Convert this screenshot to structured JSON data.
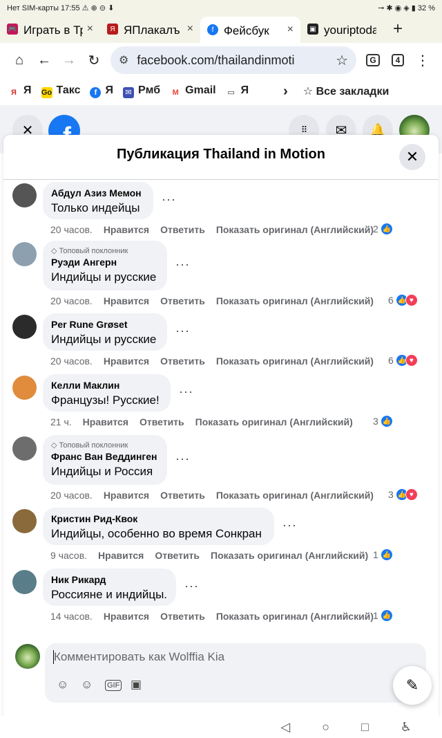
{
  "status": {
    "left": "Нет SIM-карты 17:55 ⚠ ⊕ ⊝ ⬇",
    "right": "⊸ ✱ ◉ ◈ ▮ 32 %"
  },
  "tabs": [
    {
      "label": "Играть в Тр",
      "fav_color": "#c2185b",
      "fav": "🎮"
    },
    {
      "label": "ЯПлакалъ -",
      "fav_color": "#b71c1c",
      "fav": "Я"
    },
    {
      "label": "Фейсбук",
      "fav_color": "#1877f2",
      "fav": "f"
    },
    {
      "label": "youriptoday",
      "fav_color": "#222222",
      "fav": "▣"
    }
  ],
  "tab_close": "×",
  "tab_plus": "+",
  "url": {
    "text": "facebook.com/thailandinmoti",
    "home": "⌂",
    "back": "←",
    "forward": "→",
    "reload": "↻",
    "star": "☆",
    "translate": "G",
    "tabs_count": "4",
    "menu": "⋮",
    "tune": "⚙"
  },
  "bookmarks": [
    {
      "label": "Я",
      "color": "#d32f2f",
      "ic": "Я"
    },
    {
      "label": "Такс",
      "color": "#222",
      "ic": "Go"
    },
    {
      "label": "Я",
      "color": "#1877f2",
      "ic": "f"
    },
    {
      "label": "Рмб",
      "color": "#3f51b5",
      "ic": "✉"
    },
    {
      "label": "Gmail",
      "color": "#ea4335",
      "ic": "M"
    },
    {
      "label": "Я",
      "color": "#fff",
      "ic": "▭"
    }
  ],
  "bookmarks_more": "›",
  "bookmarks_all": "☆ Все закладки",
  "fb": {
    "logo": "f",
    "close": "✕",
    "menu": "⋮⋮⋮",
    "messenger": "✉",
    "bell": "🔔"
  },
  "modal": {
    "title": "Публикация Thailand in Motion",
    "close": "✕"
  },
  "comments": [
    {
      "name": "Абдул Азиз Мемон",
      "badge": "",
      "text": "Только индейцы",
      "time": "20 часов.",
      "like": "Нравится",
      "reply": "Ответить",
      "translate": "Показать оригинал (Английский)",
      "count": "2",
      "reactions": [
        "like"
      ],
      "avatar": "#555"
    },
    {
      "name": "Руэди Ангерн",
      "badge": "Топовый поклонник",
      "text": "Индийцы и русские",
      "time": "20 часов.",
      "like": "Нравится",
      "reply": "Ответить",
      "translate": "Показать оригинал (Английский)",
      "count": "6",
      "reactions": [
        "like",
        "love"
      ],
      "avatar": "#8da0b0"
    },
    {
      "name": "Per Rune Grøset",
      "badge": "",
      "text": "Индийцы и русские",
      "time": "20 часов.",
      "like": "Нравится",
      "reply": "Ответить",
      "translate": "Показать оригинал (Английский)",
      "count": "6",
      "reactions": [
        "like",
        "love"
      ],
      "avatar": "#2b2b2b"
    },
    {
      "name": "Келли Маклин",
      "badge": "",
      "text": "Французы! Русские!",
      "time": "21 ч.",
      "like": "Нравится",
      "reply": "Ответить",
      "translate": "Показать оригинал (Английский)",
      "count": "3",
      "reactions": [
        "like"
      ],
      "avatar": "#e08c3c"
    },
    {
      "name": "Франс Ван Веддинген",
      "badge": "Топовый поклонник",
      "text": "Индийцы и Россия",
      "time": "20 часов.",
      "like": "Нравится",
      "reply": "Ответить",
      "translate": "Показать оригинал (Английский)",
      "count": "3",
      "reactions": [
        "like",
        "love"
      ],
      "avatar": "#6d6d6d"
    },
    {
      "name": "Кристин Рид-Квок",
      "badge": "",
      "text": "Индийцы, особенно во время Сонкран",
      "time": "9 часов.",
      "like": "Нравится",
      "reply": "Ответить",
      "translate": "Показать оригинал (Английский)",
      "count": "1",
      "reactions": [
        "like"
      ],
      "avatar": "#8a6a3a"
    },
    {
      "name": "Ник Рикард",
      "badge": "",
      "text": "Россияне и индийцы.",
      "time": "14 часов.",
      "like": "Нравится",
      "reply": "Ответить",
      "translate": "Показать оригинал (Английский)",
      "count": "1",
      "reactions": [
        "like"
      ],
      "avatar": "#5a7d8a"
    }
  ],
  "composer": {
    "placeholder": "Комментировать как Wolffia Kia",
    "icons": [
      "☺",
      "☺",
      "GIF",
      "▣"
    ],
    "fab": "✎"
  },
  "nav": {
    "back": "◁",
    "home": "○",
    "recent": "□",
    "access": "♿"
  }
}
